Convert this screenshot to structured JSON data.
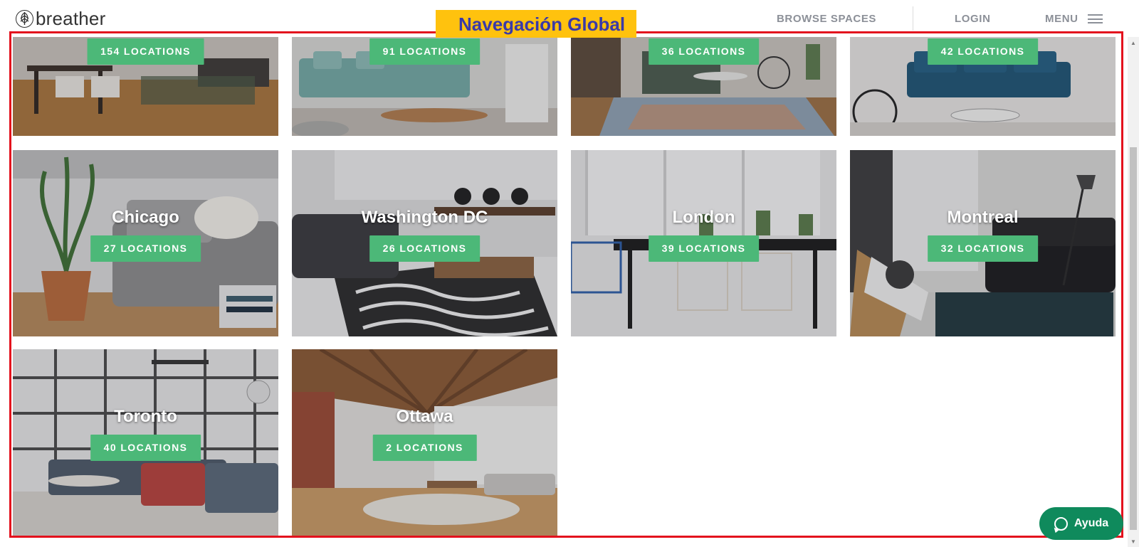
{
  "brand": {
    "name": "breather"
  },
  "annotation": {
    "label": "Navegación Global"
  },
  "nav": {
    "browse_label": "BROWSE SPACES",
    "login_label": "LOGIN",
    "menu_label": "MENU"
  },
  "cities": [
    {
      "name": "",
      "locations": "154 LOCATIONS"
    },
    {
      "name": "",
      "locations": "91 LOCATIONS"
    },
    {
      "name": "",
      "locations": "36 LOCATIONS"
    },
    {
      "name": "",
      "locations": "42 LOCATIONS"
    },
    {
      "name": "Chicago",
      "locations": "27 LOCATIONS"
    },
    {
      "name": "Washington DC",
      "locations": "26 LOCATIONS"
    },
    {
      "name": "London",
      "locations": "39 LOCATIONS"
    },
    {
      "name": "Montreal",
      "locations": "32 LOCATIONS"
    },
    {
      "name": "Toronto",
      "locations": "40 LOCATIONS"
    },
    {
      "name": "Ottawa",
      "locations": "2 LOCATIONS"
    }
  ],
  "help": {
    "label": "Ayuda"
  },
  "colors": {
    "accent_green": "#4cb878",
    "help_green": "#0f8a5c",
    "annotation_red": "#e3111d",
    "annotation_yellow": "#ffc20e",
    "annotation_text": "#3a3aa8",
    "nav_text": "#8c9098"
  }
}
